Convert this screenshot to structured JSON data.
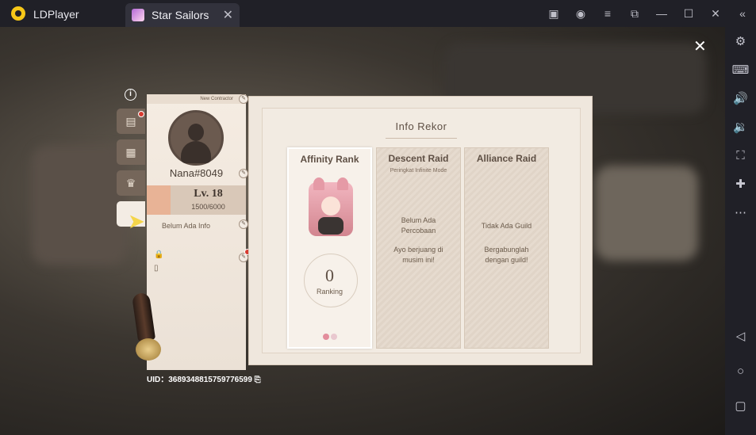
{
  "window": {
    "app_name": "LDPlayer",
    "tab_title": "Star Sailors",
    "titlebar_icons": [
      "gift-icon",
      "account-icon",
      "menu-icon",
      "restore-small-icon",
      "minimize-icon",
      "maximize-icon",
      "close-icon",
      "collapse-icon"
    ]
  },
  "right_toolbar": {
    "icons": [
      "settings-icon",
      "keyboard-icon",
      "volume-up-icon",
      "volume-down-icon",
      "fullscreen-icon",
      "add-app-icon",
      "more-icon",
      "back-icon",
      "home-icon",
      "recents-icon"
    ]
  },
  "profile": {
    "badge_text": "New Contractor",
    "name": "Nana#8049",
    "level": "Lv. 18",
    "exp": "1500/6000",
    "info": "Belum Ada Info",
    "uid": "UID：3689348815759776599"
  },
  "panel": {
    "title": "Info Rekor",
    "columns": [
      {
        "title": "Affinity Rank",
        "rank_value": "0",
        "rank_label": "Ranking"
      },
      {
        "title": "Descent Raid",
        "subtitle": "Peringkat Infinite Mode",
        "message1": "Belum Ada Percobaan",
        "message2": "Ayo berjuang di musim ini!"
      },
      {
        "title": "Alliance Raid",
        "message1": "Tidak Ada Guild",
        "message2": "Bergabunglah dengan guild!"
      }
    ]
  },
  "colors": {
    "panel_bg": "#efe7dd",
    "text_brown": "#5f5045",
    "notification_red": "#d63b30",
    "level_swatch": "#e8b396"
  }
}
